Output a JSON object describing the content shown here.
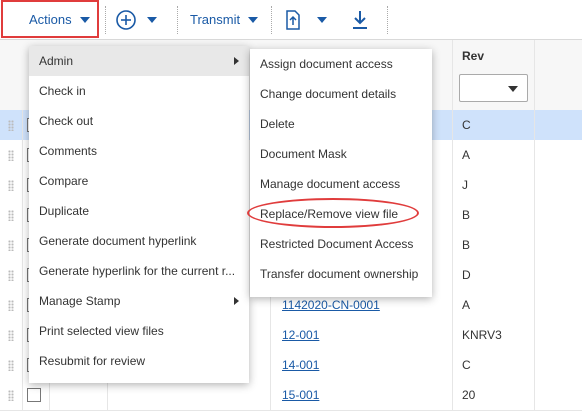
{
  "toolbar": {
    "actions_label": "Actions",
    "transmit_label": "Transmit",
    "accent": "#1a5aa6"
  },
  "actions_menu": {
    "items": [
      {
        "label": "Admin"
      },
      {
        "label": "Check in"
      },
      {
        "label": "Check out"
      },
      {
        "label": "Comments"
      },
      {
        "label": "Compare"
      },
      {
        "label": "Duplicate"
      },
      {
        "label": "Generate document hyperlink"
      },
      {
        "label": "Generate hyperlink for the current r..."
      },
      {
        "label": "Manage Stamp"
      },
      {
        "label": "Print selected view files"
      },
      {
        "label": "Resubmit for review"
      }
    ]
  },
  "admin_submenu": {
    "items": [
      {
        "label": "Assign document access"
      },
      {
        "label": "Change document details"
      },
      {
        "label": "Delete"
      },
      {
        "label": "Document Mask"
      },
      {
        "label": "Manage document access"
      },
      {
        "label": "Replace/Remove view file"
      },
      {
        "label": "Restricted Document Access"
      },
      {
        "label": "Transfer document ownership"
      }
    ]
  },
  "grid": {
    "rev_header": "Rev",
    "rows": [
      {
        "doc": "",
        "rev": "C"
      },
      {
        "doc": "",
        "rev": "A"
      },
      {
        "doc": "",
        "rev": "J"
      },
      {
        "doc": "",
        "rev": "B"
      },
      {
        "doc": "",
        "rev": "B"
      },
      {
        "doc": "",
        "rev": "D"
      },
      {
        "doc": "1142020-CN-0001",
        "rev": "A"
      },
      {
        "doc": "12-001",
        "rev": "KNRV3"
      },
      {
        "doc": "14-001",
        "rev": "C"
      },
      {
        "doc": "15-001",
        "rev": "20"
      }
    ]
  },
  "colors": {
    "highlight": "#e03c3c",
    "selected_row": "#cfe2fb"
  }
}
